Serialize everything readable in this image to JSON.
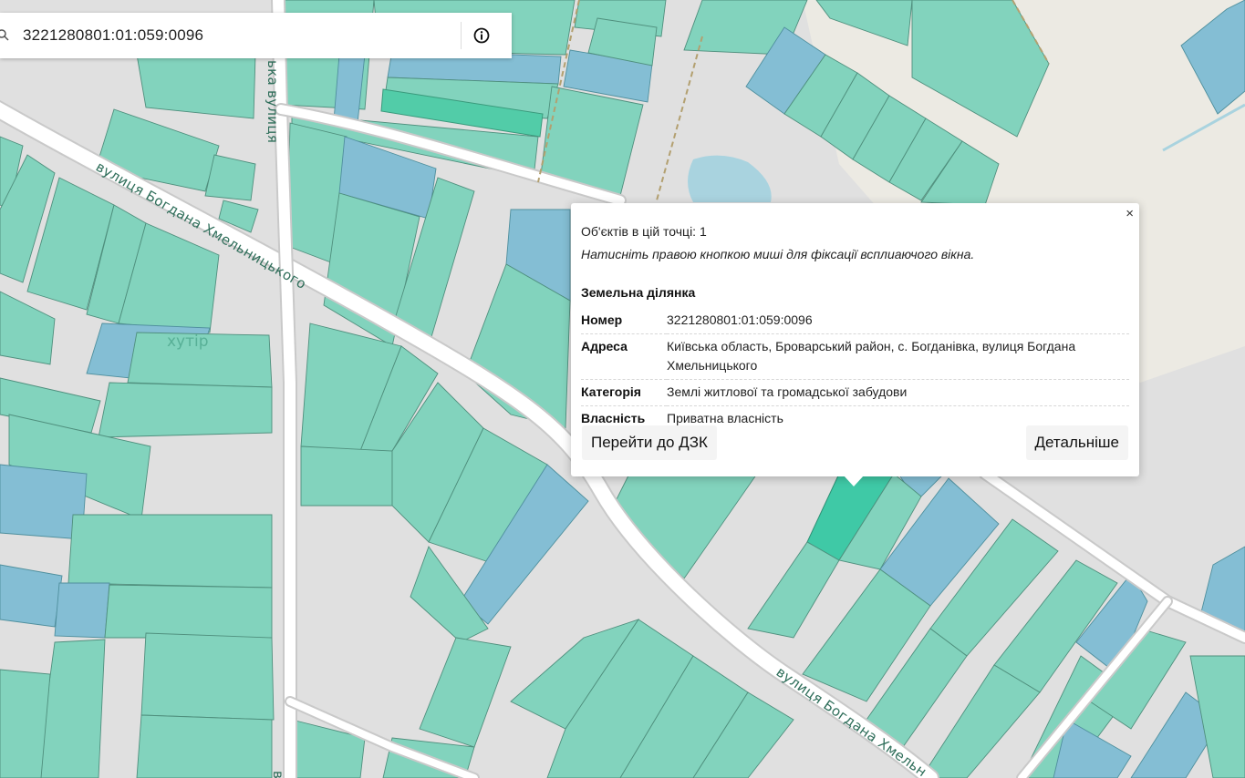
{
  "search": {
    "value": "3221280801:01:059:0096",
    "search_icon": "search-icon",
    "info_icon": "info-icon"
  },
  "map": {
    "street_labels": {
      "main_upper": "вулиця Богдана Хмельницького",
      "main_lower": "вулиця Богдана Хмельн",
      "vertical": "ька вулиця",
      "vertical_bottom": "в"
    },
    "place_labels": {
      "khutir": "хутір"
    },
    "colors": {
      "parcel_private": "#82d3bd",
      "parcel_other": "#84bed4",
      "parcel_selected": "#3fc9a6",
      "road": "#ffffff",
      "background": "#e0e0e0"
    }
  },
  "popup": {
    "close_label": "×",
    "count_text": "Об'єктів в цій точці: 1",
    "hint_text": "Натисніть правою кнопкою миші для фіксації всплиаючого вікна.",
    "section_title": "Земельна ділянка",
    "attributes": [
      {
        "key": "Номер",
        "value": "3221280801:01:059:0096"
      },
      {
        "key": "Адреса",
        "value": "Київська область, Броварський район, с. Богданівка, вулиця Богдана Хмельницького"
      },
      {
        "key": "Категорія",
        "value": "Землі житлової та громадської забудови"
      },
      {
        "key": "Власність",
        "value": "Приватна власність"
      }
    ],
    "button_dzk": "Перейти до ДЗК",
    "button_details": "Детальніше"
  }
}
